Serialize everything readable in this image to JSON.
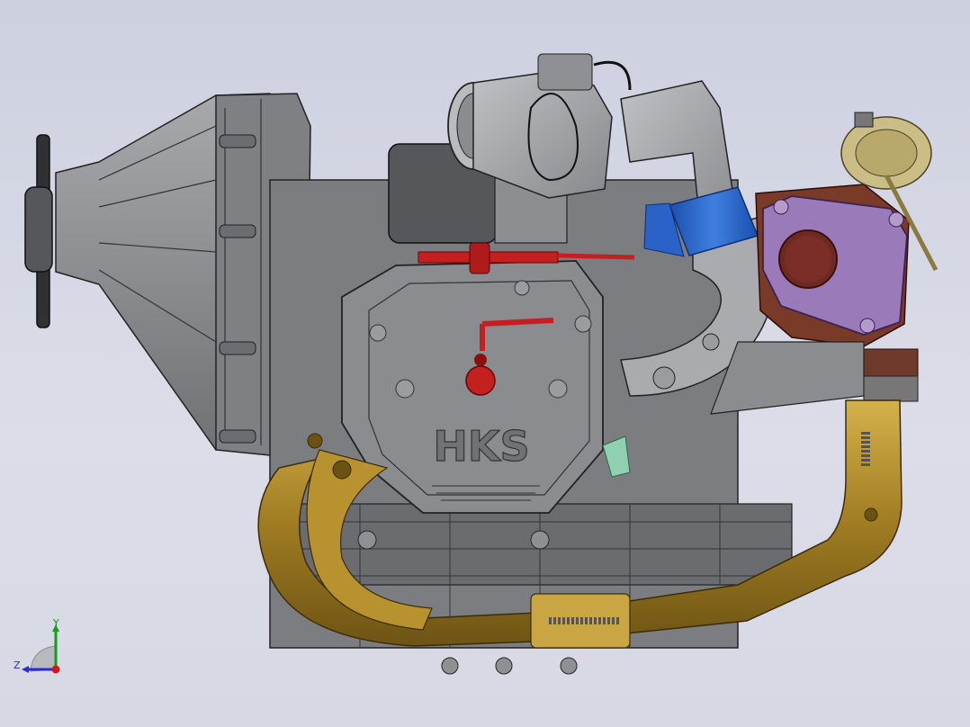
{
  "viewport": {
    "background_top": "#cdd0e0",
    "background_bottom": "#d6d8e4"
  },
  "model": {
    "engraving": "HKS",
    "colors": {
      "casting": "#8c8e92",
      "casting_dark": "#5d5f63",
      "exhaust": "#b08a2a",
      "intercooler_hose": "#2a62c8",
      "oil_line": "#c42020",
      "turbine_flange": "#9a7ab8",
      "turbine_housing": "#7a3a28",
      "wastegate": "#c8b878",
      "fitting": "#8fd0b0"
    }
  },
  "triad": {
    "y_label": "Y",
    "z_label": "Z",
    "icons": [
      "triad-y-arrow-icon",
      "triad-z-arrow-icon",
      "triad-x-dot-icon"
    ]
  }
}
